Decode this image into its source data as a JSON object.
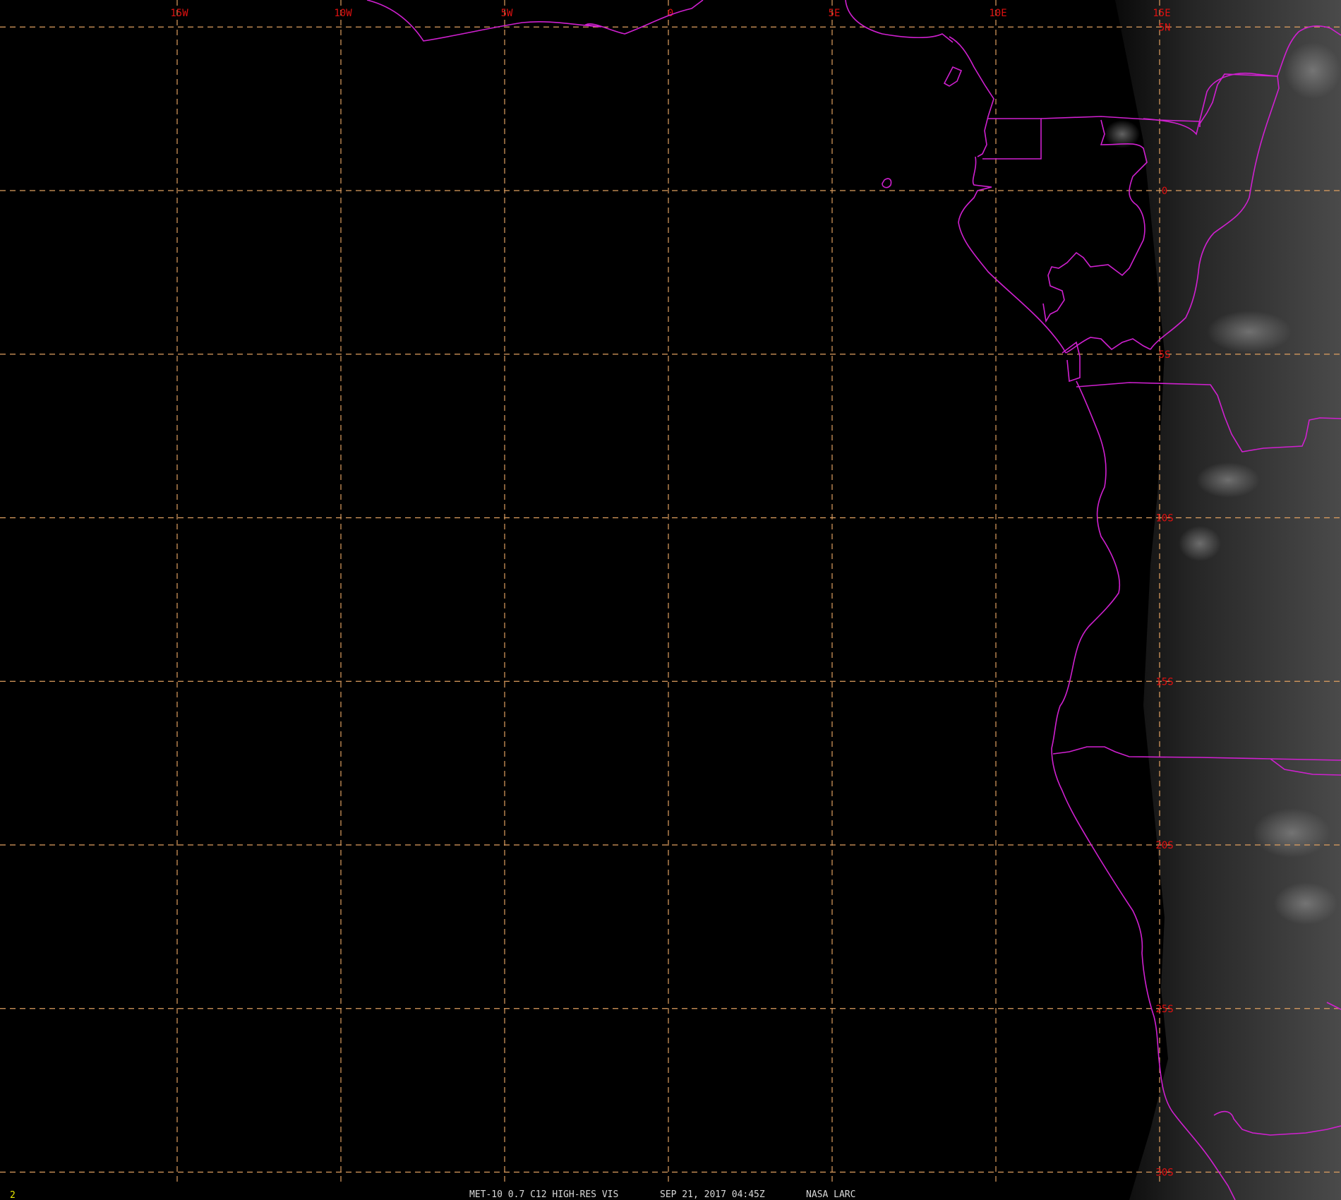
{
  "colors": {
    "background": "#000000",
    "grid": "#e0a060",
    "grid_labels": "#e01010",
    "boundaries": "#d020d0",
    "footer_text": "#d8d8d8",
    "frame_number": "#e8e800"
  },
  "frame_number": "2",
  "footer": {
    "product": "MET-10 0.7 C12 HIGH-RES VIS",
    "datetime": "SEP 21, 2017 04:45Z",
    "source": "NASA LARC"
  },
  "grid": {
    "longitudes": [
      {
        "label": "15W",
        "value": -15
      },
      {
        "label": "10W",
        "value": -10
      },
      {
        "label": "5W",
        "value": -5
      },
      {
        "label": "0",
        "value": 0
      },
      {
        "label": "5E",
        "value": 5
      },
      {
        "label": "10E",
        "value": 10
      },
      {
        "label": "15E",
        "value": 15
      }
    ],
    "latitudes": [
      {
        "label": "5N",
        "value": 5
      },
      {
        "label": "0",
        "value": 0
      },
      {
        "label": "5S",
        "value": -5
      },
      {
        "label": "10S",
        "value": -10
      },
      {
        "label": "15S",
        "value": -15
      },
      {
        "label": "20S",
        "value": -20
      },
      {
        "label": "25S",
        "value": -25
      },
      {
        "label": "30S",
        "value": -30
      }
    ]
  }
}
